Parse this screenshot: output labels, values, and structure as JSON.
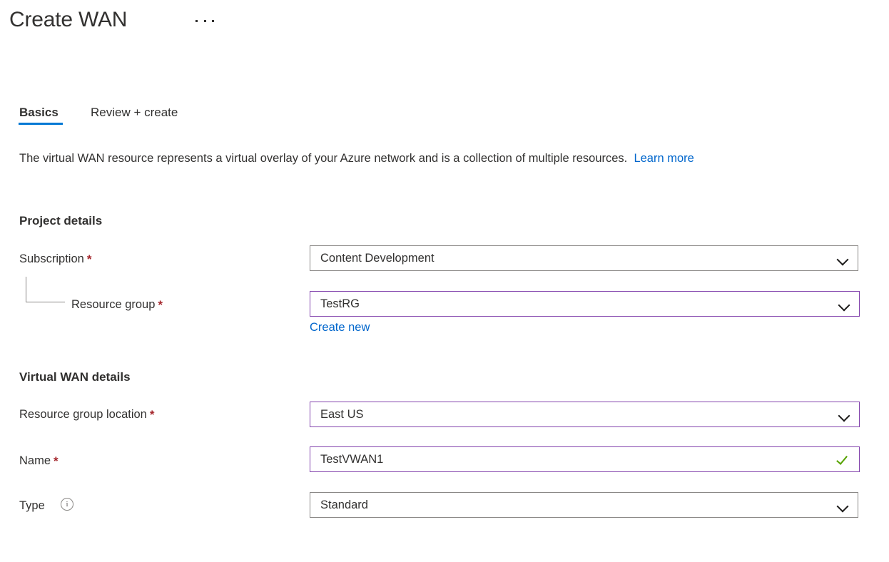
{
  "header": {
    "title": "Create WAN",
    "more_menu_label": "..."
  },
  "tabs": [
    {
      "label": "Basics",
      "active": true
    },
    {
      "label": "Review + create",
      "active": false
    }
  ],
  "description": {
    "text": "The virtual WAN resource represents a virtual overlay of your Azure network and is a collection of multiple resources.",
    "link_label": "Learn more"
  },
  "sections": {
    "project_details": {
      "heading": "Project details",
      "fields": {
        "subscription": {
          "label": "Subscription",
          "required_marker": "*",
          "value": "Content Development",
          "icon": "chevron-down-icon",
          "focused": false
        },
        "resource_group": {
          "label": "Resource group",
          "required_marker": "*",
          "value": "TestRG",
          "icon": "chevron-down-icon",
          "focused": true,
          "create_new_label": "Create new"
        }
      }
    },
    "virtual_wan_details": {
      "heading": "Virtual WAN details",
      "fields": {
        "resource_group_location": {
          "label": "Resource group location",
          "required_marker": "*",
          "value": "East US",
          "icon": "chevron-down-icon",
          "focused": true
        },
        "name": {
          "label": "Name",
          "required_marker": "*",
          "value": "TestVWAN1",
          "icon": "check-icon",
          "focused": true
        },
        "type": {
          "label": "Type",
          "info_icon": "info-icon",
          "info_glyph": "i",
          "value": "Standard",
          "icon": "chevron-down-icon",
          "focused": false
        }
      }
    }
  },
  "colors": {
    "accent_blue": "#0078d4",
    "link_blue": "#0066cc",
    "required_red": "#a4262c",
    "focus_purple": "#8344ad",
    "success_green": "#57a300",
    "border_gray": "#8a8886",
    "text_primary": "#323130"
  }
}
